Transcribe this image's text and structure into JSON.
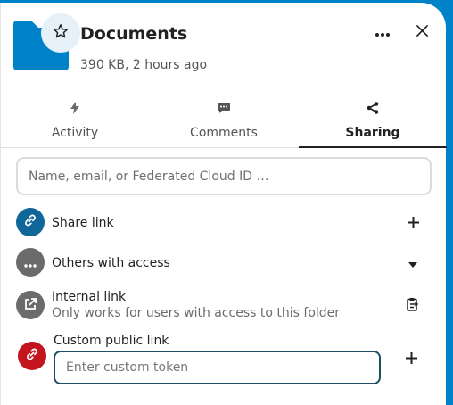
{
  "header": {
    "title": "Documents",
    "subtitle": "390 KB, 2 hours ago",
    "folder_icon": "folder-icon",
    "star_icon": "star-icon",
    "more_icon": "more-horizontal-icon",
    "close_icon": "close-icon",
    "accent_color": "#0082c9"
  },
  "tabs": [
    {
      "label": "Activity",
      "icon": "lightning-icon",
      "active": false
    },
    {
      "label": "Comments",
      "icon": "comment-icon",
      "active": false
    },
    {
      "label": "Sharing",
      "icon": "share-icon",
      "active": true
    }
  ],
  "sharing": {
    "search_placeholder": "Name, email, or Federated Cloud ID …",
    "share_link": {
      "label": "Share link",
      "icon": "link-icon",
      "action_icon": "plus-icon",
      "color": "#0f6699"
    },
    "others": {
      "label": "Others with access",
      "icon": "more-horizontal-icon",
      "action_icon": "triangle-down-icon",
      "color": "#6b6b6b"
    },
    "internal": {
      "label": "Internal link",
      "sublabel": "Only works for users with access to this folder",
      "icon": "external-link-icon",
      "action_icon": "clipboard-icon",
      "color": "#6b6b6b"
    },
    "custom": {
      "label": "Custom public link",
      "placeholder": "Enter custom token",
      "icon": "link-icon",
      "action_icon": "plus-icon",
      "color": "#c3151e"
    }
  }
}
